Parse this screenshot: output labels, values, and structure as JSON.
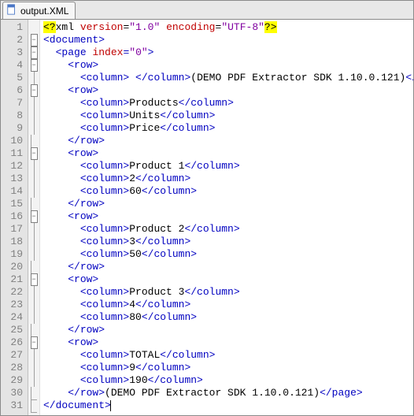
{
  "tab": {
    "label": "output.XML"
  },
  "gutter": {
    "lines": [
      "1",
      "2",
      "3",
      "4",
      "5",
      "6",
      "7",
      "8",
      "9",
      "10",
      "11",
      "12",
      "13",
      "14",
      "15",
      "16",
      "17",
      "18",
      "19",
      "20",
      "21",
      "22",
      "23",
      "24",
      "25",
      "26",
      "27",
      "28",
      "29",
      "30",
      "31"
    ]
  },
  "fold": [
    "",
    "minus",
    "minus",
    "minus",
    "line",
    "minus",
    "line",
    "line",
    "line",
    "end",
    "minus",
    "line",
    "line",
    "line",
    "end",
    "minus",
    "line",
    "line",
    "line",
    "end",
    "minus",
    "line",
    "line",
    "line",
    "end",
    "minus",
    "line",
    "line",
    "line",
    "end",
    "end"
  ],
  "xml": {
    "decl": {
      "open": "<?",
      "name": "xml",
      "a1": "version",
      "v1": "\"1.0\"",
      "a2": "encoding",
      "v2": "\"UTF-8\"",
      "close": "?>"
    },
    "tags": {
      "document_open": "<document>",
      "document_close": "</document>",
      "page_open_pre": "<page ",
      "page_attr": "index",
      "page_val": "\"0\"",
      "page_open_post": ">",
      "page_close": "</page>",
      "row_open": "<row>",
      "row_close": "</row>",
      "col_open": "<column>",
      "col_close": "</column>"
    },
    "texts": {
      "sp": " ",
      "demo": "(DEMO PDF Extractor SDK 1.10.0.121)",
      "products": "Products",
      "units": "Units",
      "price": "Price",
      "p1": "Product 1",
      "p1q": "2",
      "p1p": "60",
      "p2": "Product 2",
      "p2q": "3",
      "p2p": "50",
      "p3": "Product 3",
      "p3q": "4",
      "p3p": "80",
      "total": "TOTAL",
      "tq": "9",
      "tp": "190"
    }
  },
  "chart_data": {
    "type": "table",
    "title": "(DEMO PDF Extractor SDK 1.10.0.121)",
    "columns": [
      "Products",
      "Units",
      "Price"
    ],
    "rows": [
      [
        "Product 1",
        2,
        60
      ],
      [
        "Product 2",
        3,
        50
      ],
      [
        "Product 3",
        4,
        80
      ],
      [
        "TOTAL",
        9,
        190
      ]
    ]
  }
}
